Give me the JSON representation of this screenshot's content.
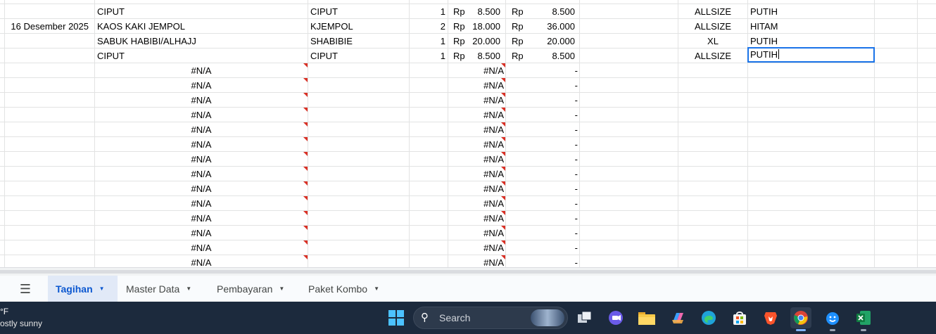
{
  "sheet": {
    "rows": [
      {
        "date": "",
        "product": "CIPUT",
        "brand": "CIPUT",
        "qty": "1",
        "cur1": "Rp",
        "price": "8.500",
        "cur2": "Rp",
        "total": "8.500",
        "size": "ALLSIZE",
        "color": "PUTIH"
      },
      {
        "date": "16 Desember 2025",
        "product": "KAOS KAKI JEMPOL",
        "brand": "KJEMPOL",
        "qty": "2",
        "cur1": "Rp",
        "price": "18.000",
        "cur2": "Rp",
        "total": "36.000",
        "size": "ALLSIZE",
        "color": "HITAM"
      },
      {
        "date": "",
        "product": "SABUK HABIBI/ALHAJJ",
        "brand": "SHABIBIE",
        "qty": "1",
        "cur1": "Rp",
        "price": "20.000",
        "cur2": "Rp",
        "total": "20.000",
        "size": "XL",
        "color": "PUTIH"
      },
      {
        "date": "",
        "product": "CIPUT",
        "brand": "CIPUT",
        "qty": "1",
        "cur1": "Rp",
        "price": "8.500",
        "cur2": "Rp",
        "total": "8.500",
        "size": "ALLSIZE",
        "color": ""
      }
    ],
    "selected_cell_value": "PUTIH",
    "error_value": "#N/A",
    "empty_total": "-",
    "error_row_count": 14
  },
  "tabs": {
    "all_sheets_icon": "hamburger-menu-icon",
    "items": [
      {
        "label": "Tagihan",
        "active": true
      },
      {
        "label": "Master Data",
        "active": false
      },
      {
        "label": "Pembayaran",
        "active": false
      },
      {
        "label": "Paket Kombo",
        "active": false
      }
    ]
  },
  "taskbar": {
    "weather_temp": "°F",
    "weather_desc": "ostly sunny",
    "search_placeholder": "Search",
    "accent": "#1c2a3d"
  }
}
